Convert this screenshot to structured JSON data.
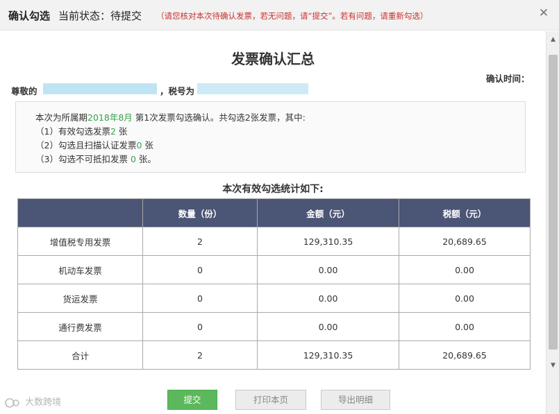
{
  "window": {
    "title": "确认勾选",
    "status": "当前状态：待提交",
    "note": "（请您核对本次待确认发票，若无问题，请“提交”。若有问题，请重新勾选）",
    "close_glyph": "✕"
  },
  "doc": {
    "title": "发票确认汇总",
    "confirm_time_label": "确认时间："
  },
  "greeting": {
    "prefix": "尊敬的",
    "mid": "，税号为"
  },
  "summary": {
    "line1_a": "本次为所属期",
    "period": "2018年8月",
    "line1_b": " 第1次发票勾选确认。共勾选2张发票，其中:",
    "line2_a": "（1）有效勾选发票",
    "line2_val": "2",
    "line2_b": " 张",
    "line3_a": "（2）勾选且扫描认证发票",
    "line3_val": "0",
    "line3_b": " 张",
    "line4_a": "（3）勾选不可抵扣发票 ",
    "line4_val": "0",
    "line4_b": " 张。"
  },
  "stats": {
    "title": "本次有效勾选统计如下:",
    "headers": [
      "",
      "数量（份）",
      "金额（元）",
      "税额（元）"
    ],
    "rows": [
      [
        "增值税专用发票",
        "2",
        "129,310.35",
        "20,689.65"
      ],
      [
        "机动车发票",
        "0",
        "0.00",
        "0.00"
      ],
      [
        "货运发票",
        "0",
        "0.00",
        "0.00"
      ],
      [
        "通行费发票",
        "0",
        "0.00",
        "0.00"
      ],
      [
        "合计",
        "2",
        "129,310.35",
        "20,689.65"
      ]
    ]
  },
  "buttons": {
    "submit": "提交",
    "print": "打印本页",
    "export": "导出明细"
  },
  "watermark": "大数跨境",
  "scrollbar": {
    "up": "▲",
    "down": "▼"
  },
  "colors": {
    "header_bg": "#4b5575",
    "highlight": "#35a04a",
    "note_red": "#c9302c",
    "submit_green": "#5cb85c"
  }
}
